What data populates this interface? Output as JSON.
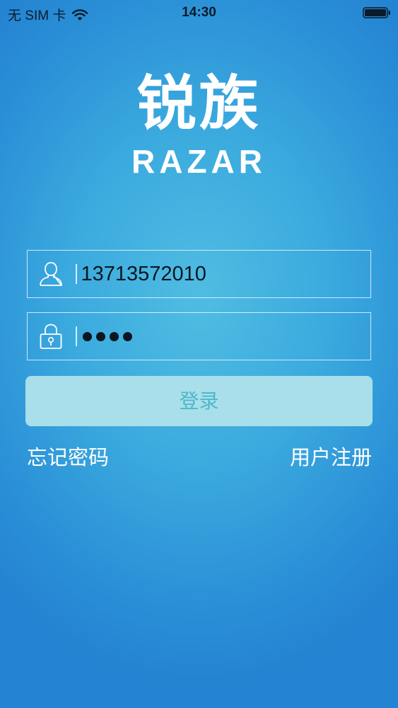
{
  "status_bar": {
    "carrier": "无 SIM 卡",
    "time": "14:30"
  },
  "logo": {
    "chinese": "锐族",
    "english": "RAZAR"
  },
  "form": {
    "phone_value": "13713572010",
    "password_dot_count": 4,
    "login_label": "登录"
  },
  "links": {
    "forgot_password": "忘记密码",
    "register": "用户注册"
  },
  "colors": {
    "background": "#3aa9de",
    "button": "#a8dfea",
    "button_text": "#4fb7c8"
  }
}
